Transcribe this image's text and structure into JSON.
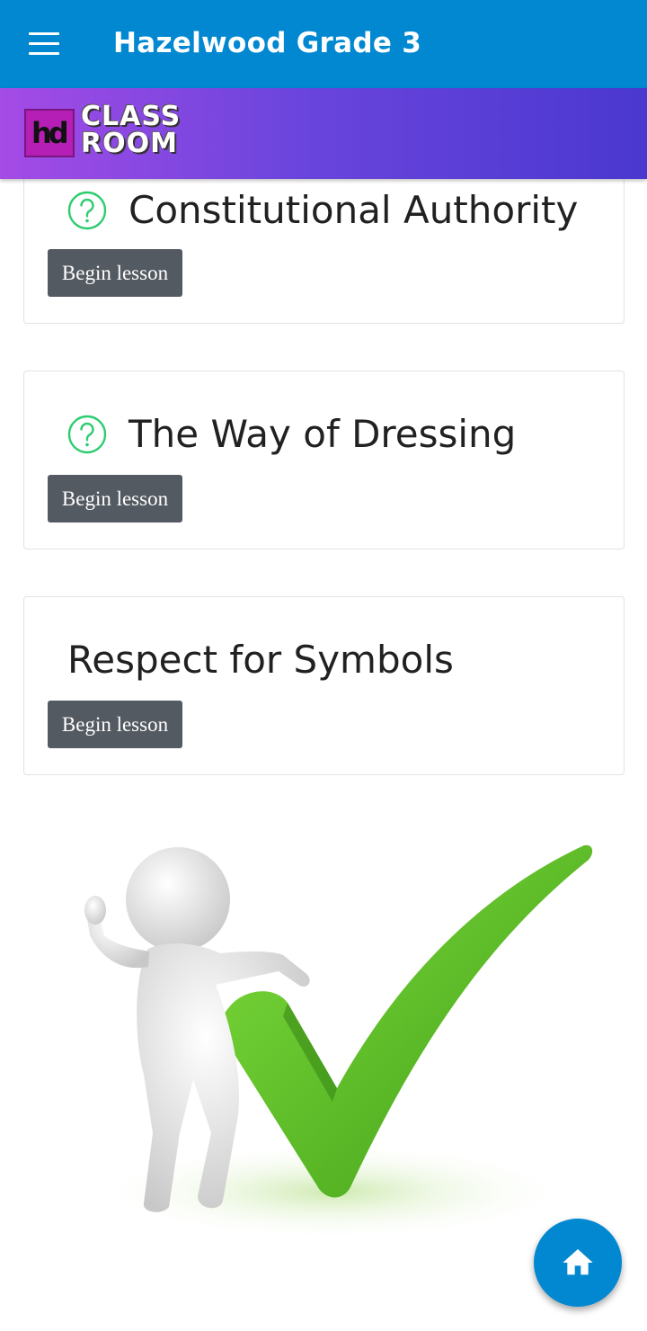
{
  "appbar": {
    "title": "Hazelwood Grade 3",
    "menu_icon": "hamburger-menu-icon",
    "color": "#0288d1"
  },
  "banner": {
    "logo_mark": "hd",
    "logo_line1": "CLASS",
    "logo_line2": "ROOM"
  },
  "lessons": [
    {
      "title": "Constitutional Authority",
      "icon": "question-circle-icon",
      "button_label": "Begin lesson"
    },
    {
      "title": "The Way of Dressing",
      "icon": "question-circle-icon",
      "button_label": "Begin lesson"
    },
    {
      "title": "Respect for Symbols",
      "icon": "",
      "button_label": "Begin lesson"
    }
  ],
  "colors": {
    "icon_green": "#2ecc71",
    "button_bg": "#545a62",
    "check_green": "#5fbf2a"
  },
  "fab": {
    "icon": "home-icon"
  }
}
